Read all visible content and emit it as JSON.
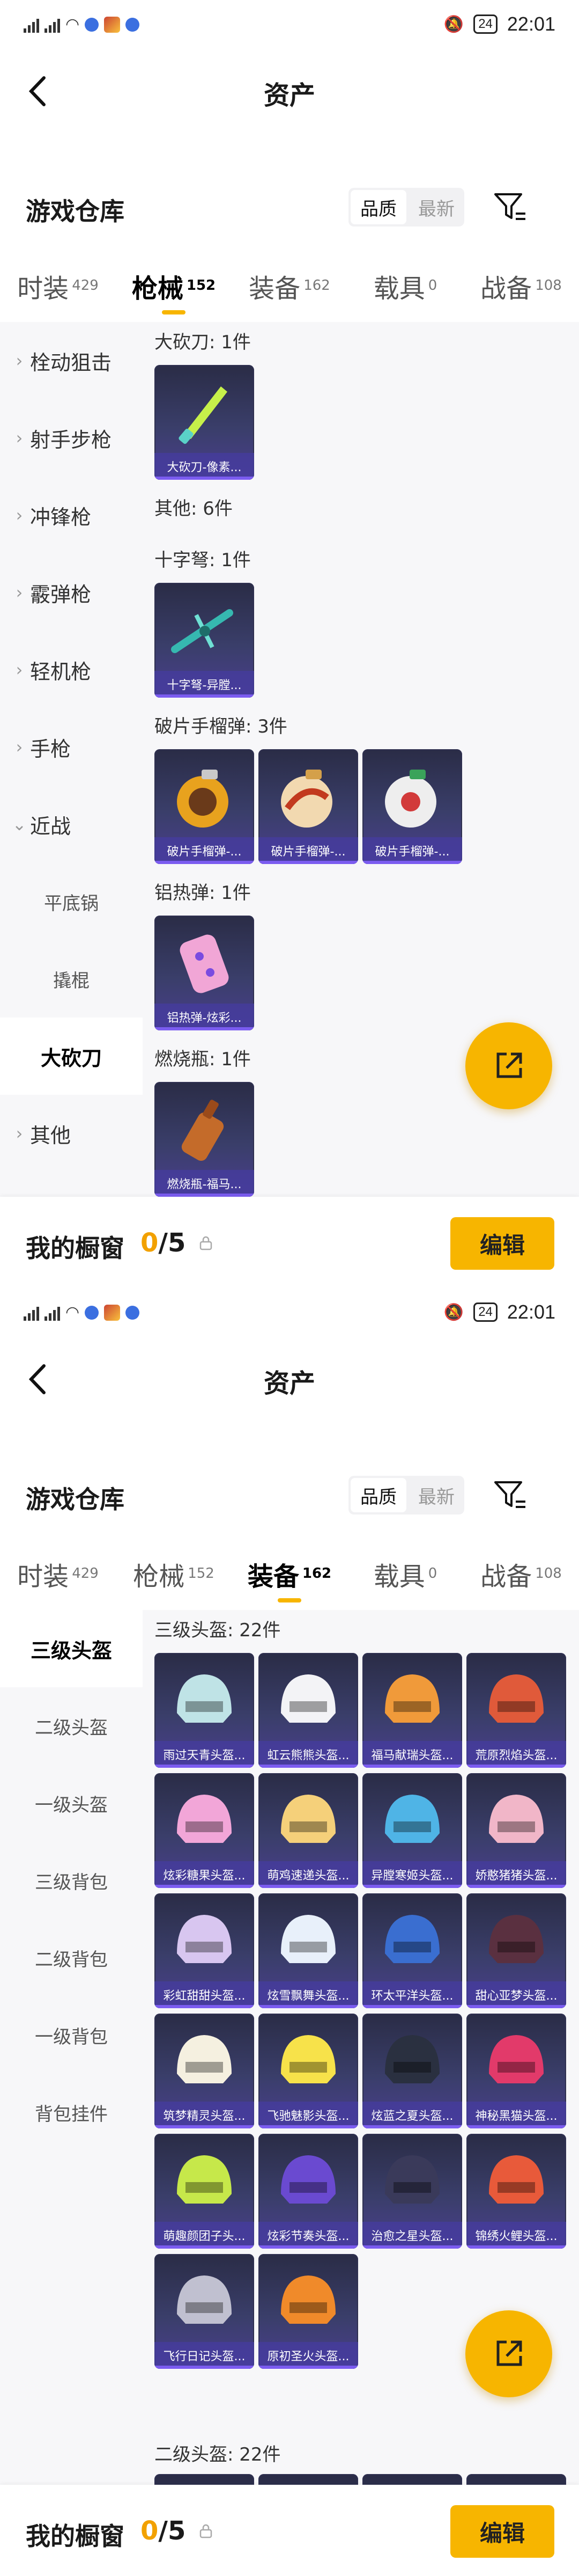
{
  "status": {
    "left_text": "46 46 56",
    "time": "22:01",
    "battery": "24"
  },
  "header": {
    "title": "资产"
  },
  "section": {
    "title": "游戏仓库",
    "sort_quality": "品质",
    "sort_latest": "最新"
  },
  "tabs": [
    {
      "label": "时装",
      "count": "429"
    },
    {
      "label": "枪械",
      "count": "152"
    },
    {
      "label": "装备",
      "count": "162"
    },
    {
      "label": "载具",
      "count": "0"
    },
    {
      "label": "战备",
      "count": "108"
    }
  ],
  "screen1": {
    "sidebar": [
      "栓动狙击",
      "射手步枪",
      "冲锋枪",
      "霰弹枪",
      "轻机枪",
      "手枪",
      "近战",
      "平底锅",
      "撬棍",
      "大砍刀",
      "其他"
    ],
    "groups": [
      {
        "label": "大砍刀: 1件",
        "items": [
          "大砍刀-像素..."
        ]
      },
      {
        "label": "其他: 6件",
        "items": []
      },
      {
        "label": "十字弩: 1件",
        "items": [
          "十字弩-异膛..."
        ]
      },
      {
        "label": "破片手榴弹: 3件",
        "items": [
          "破片手榴弹-...",
          "破片手榴弹-...",
          "破片手榴弹-..."
        ]
      },
      {
        "label": "铝热弹: 1件",
        "items": [
          "铝热弹-炫彩..."
        ]
      },
      {
        "label": "燃烧瓶: 1件",
        "items": [
          "燃烧瓶-福马..."
        ]
      }
    ]
  },
  "screen2": {
    "sidebar": [
      "三级头盔",
      "二级头盔",
      "一级头盔",
      "三级背包",
      "二级背包",
      "一级背包",
      "背包挂件"
    ],
    "group1": {
      "label": "三级头盔: 22件",
      "items": [
        "雨过天青头盔...",
        "虹云熊熊头盔...",
        "福马献瑞头盔...",
        "荒原烈焰头盔...",
        "炫彩糖果头盔...",
        "萌鸡速递头盔...",
        "异膛寒姬头盔...",
        "娇憨猪猪头盔...",
        "彩虹甜甜头盔...",
        "炫雪飘舞头盔...",
        "环太平洋头盔...",
        "甜心亚梦头盔...",
        "筑梦精灵头盔...",
        "飞驰魅影头盔...",
        "炫蓝之夏头盔...",
        "神秘黑猫头盔...",
        "萌趣颜团子头...",
        "炫彩节奏头盔...",
        "治愈之星头盔...",
        "锦绣火鲤头盔...",
        "飞行日记头盔...",
        "原初圣火头盔..."
      ]
    },
    "group2": {
      "label": "二级头盔: 22件"
    }
  },
  "bottom": {
    "title": "我的橱窗",
    "current": "0",
    "total": "/5",
    "edit": "编辑"
  },
  "colors": {
    "accent": "#f7b500",
    "card_bg": "#2e3050",
    "caption_bg": "#463ca0"
  }
}
